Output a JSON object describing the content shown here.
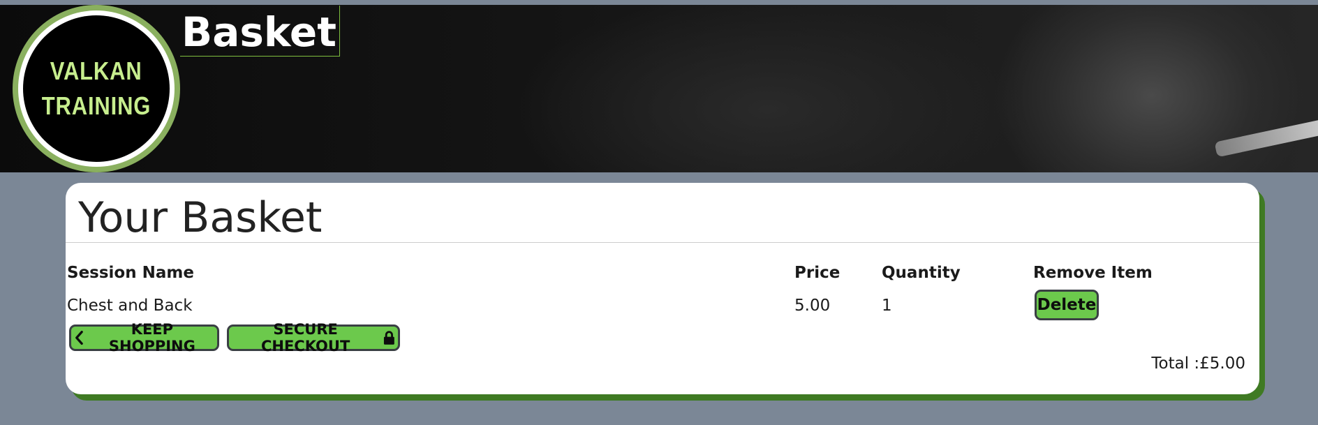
{
  "header": {
    "title": "Basket",
    "logo": {
      "line1": "VALKAN",
      "line2": "TRAINING"
    }
  },
  "basket": {
    "heading": "Your Basket",
    "columns": [
      "Session Name",
      "Price",
      "Quantity",
      "Remove Item"
    ],
    "items": [
      {
        "name": "Chest and Back",
        "price": "5.00",
        "quantity": "1",
        "action_label": "Delete"
      }
    ],
    "keep_shopping_label": "KEEP SHOPPING",
    "checkout_label": "SECURE CHECKOUT",
    "total_label": "Total :£5.00"
  },
  "colors": {
    "accent_green": "#6cc94c",
    "card_shadow_green": "#3f7a23",
    "page_background": "#7b8796",
    "logo_text": "#c7ee8e"
  },
  "icons": {
    "keep_shopping": "chevron-left-icon",
    "checkout": "lock-icon"
  }
}
